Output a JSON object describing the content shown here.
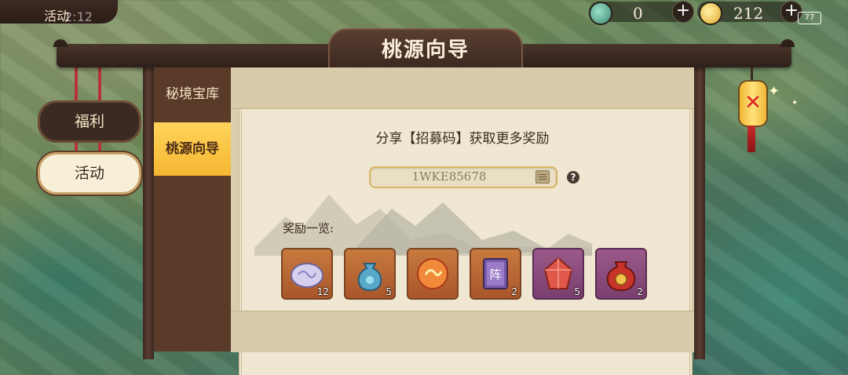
{
  "status": {
    "tag": "活动",
    "clock": "2:12",
    "battery": "77"
  },
  "currencies": [
    {
      "icon": "jade-coin-icon",
      "value": "0",
      "color": "#4fa08a"
    },
    {
      "icon": "gold-ingot-icon",
      "value": "212",
      "color": "#f0c24a"
    }
  ],
  "side_nav": [
    {
      "label": "福利",
      "active": false
    },
    {
      "label": "活动",
      "active": true
    }
  ],
  "window": {
    "title": "桃源向导"
  },
  "tabs": [
    {
      "label": "秘境宝库",
      "active": false
    },
    {
      "label": "桃源向导",
      "active": true
    }
  ],
  "content": {
    "share_title": "分享【招募码】获取更多奖励",
    "code": "1WKE85678",
    "help_symbol": "?",
    "rewards_label": "奖励一览:",
    "rewards": [
      {
        "icon": "silver-cloud-stone-icon",
        "count": "12",
        "frame": "orange"
      },
      {
        "icon": "blue-pouch-icon",
        "count": "5",
        "frame": "orange"
      },
      {
        "icon": "fire-orb-icon",
        "count": "",
        "frame": "orange"
      },
      {
        "icon": "formation-book-icon",
        "count": "2",
        "frame": "orange",
        "glyph": "阵"
      },
      {
        "icon": "red-crystal-icon",
        "count": "5",
        "frame": "purple"
      },
      {
        "icon": "lucky-bag-icon",
        "count": "2",
        "frame": "purple"
      }
    ]
  },
  "close": {
    "symbol": "✕"
  }
}
